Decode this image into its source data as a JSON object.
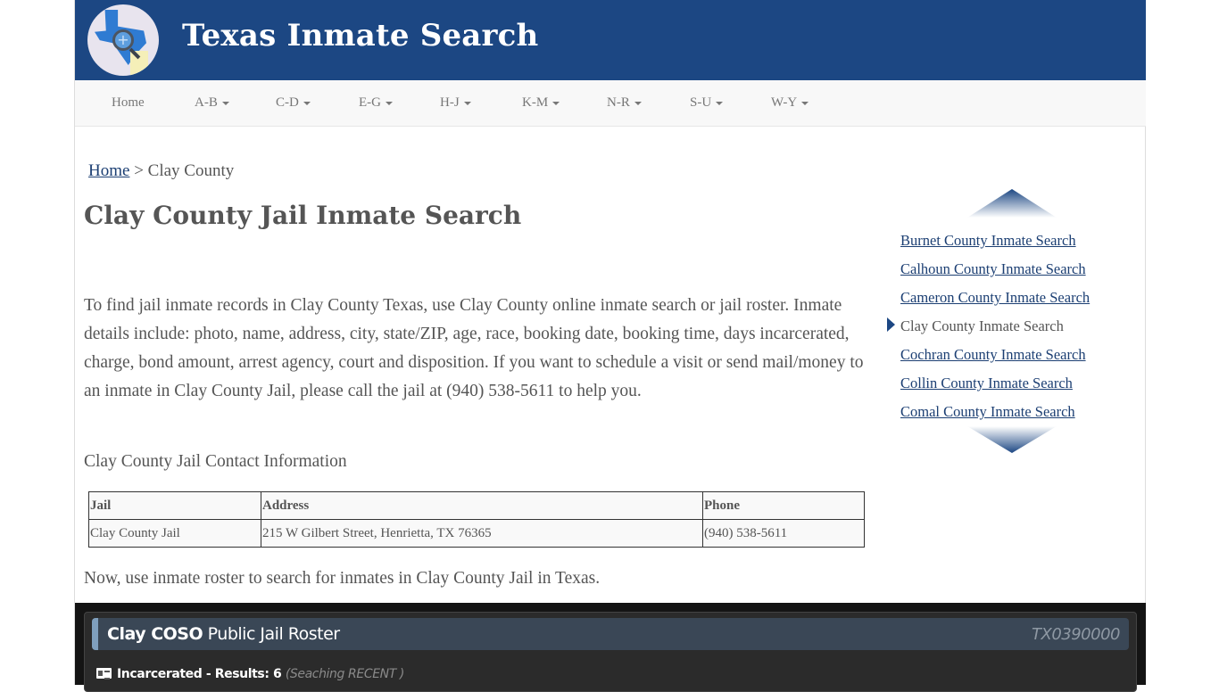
{
  "header": {
    "site_title": "Texas Inmate Search",
    "logo_icon": "texas-map-magnifier-icon",
    "brand_color": "#1c4783"
  },
  "nav": {
    "items": [
      {
        "label": "Home",
        "dropdown": false
      },
      {
        "label": "A-B",
        "dropdown": true
      },
      {
        "label": "C-D",
        "dropdown": true
      },
      {
        "label": "E-G",
        "dropdown": true
      },
      {
        "label": "H-J",
        "dropdown": true
      },
      {
        "label": "K-M",
        "dropdown": true
      },
      {
        "label": "N-R",
        "dropdown": true
      },
      {
        "label": "S-U",
        "dropdown": true
      },
      {
        "label": "W-Y",
        "dropdown": true
      }
    ]
  },
  "breadcrumb": {
    "home": "Home",
    "separator": ">",
    "current": "Clay County"
  },
  "main": {
    "title": "Clay County Jail Inmate Search",
    "intro": "To find jail inmate records in Clay County Texas, use Clay County online inmate search or jail roster. Inmate details include: photo, name, address, city, state/ZIP, age, race, booking date, booking time, days incarcerated, charge, bond amount, arrest agency, court and disposition. If you want to schedule a visit or send mail/money to an inmate in Clay County Jail, please call the jail at (940) 538-5611 to help you.",
    "contact_heading": "Clay County Jail Contact Information",
    "contact_table": {
      "headers": [
        "Jail",
        "Address",
        "Phone"
      ],
      "rows": [
        [
          "Clay County Jail",
          "215 W Gilbert Street, Henrietta, TX 76365",
          "(940) 538-5611"
        ]
      ]
    },
    "roster_intro": "Now, use inmate roster to search for inmates in Clay County Jail in Texas."
  },
  "sidebar": {
    "links": [
      {
        "label": "Burnet County Inmate Search",
        "active": false
      },
      {
        "label": "Calhoun County Inmate Search",
        "active": false
      },
      {
        "label": "Cameron County Inmate Search",
        "active": false
      },
      {
        "label": "Clay County Inmate Search",
        "active": true
      },
      {
        "label": "Cochran County Inmate Search",
        "active": false
      },
      {
        "label": "Collin County Inmate Search",
        "active": false
      },
      {
        "label": "Comal County Inmate Search",
        "active": false
      }
    ]
  },
  "roster": {
    "title_bold": "Clay COSO",
    "title_rest": " Public Jail Roster",
    "agency_id": "TX0390000",
    "status_label": "Incarcerated - Results: 6",
    "searching_note": "(Seaching RECENT )"
  }
}
